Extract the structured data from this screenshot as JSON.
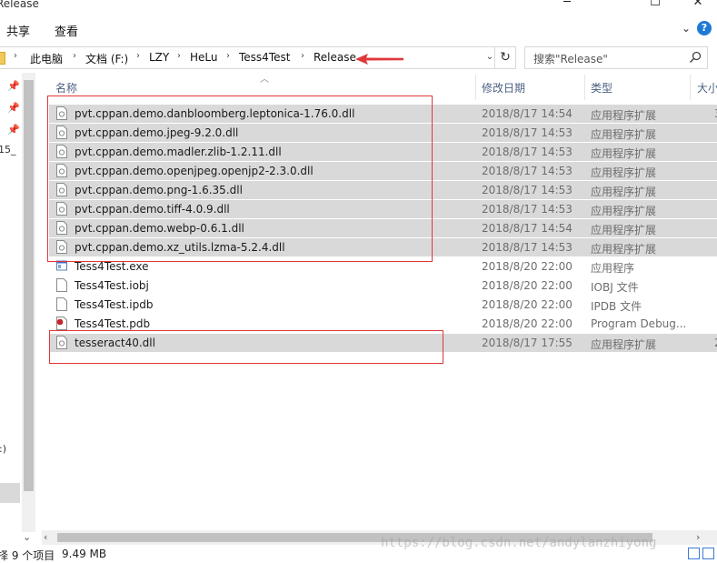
{
  "window": {
    "title": "Release"
  },
  "ribbon": {
    "tabs": [
      "共享",
      "查看"
    ]
  },
  "address": {
    "crumbs": [
      "此电脑",
      "文档 (F:)",
      "LZY",
      "HeLu",
      "Tess4Test",
      "Release"
    ]
  },
  "search": {
    "placeholder": "搜索\"Release\""
  },
  "nav": {
    "text1": "15_",
    "text2": ":)"
  },
  "columns": {
    "name": "名称",
    "date": "修改日期",
    "type": "类型",
    "size": "大小"
  },
  "files": [
    {
      "name": "pvt.cppan.demo.danbloomberg.leptonica-1.76.0.dll",
      "date": "2018/8/17 14:54",
      "type": "应用程序扩展",
      "size": "3",
      "icon": "dll-icon",
      "selected": true
    },
    {
      "name": "pvt.cppan.demo.jpeg-9.2.0.dll",
      "date": "2018/8/17 14:53",
      "type": "应用程序扩展",
      "size": "",
      "icon": "dll-icon",
      "selected": true
    },
    {
      "name": "pvt.cppan.demo.madler.zlib-1.2.11.dll",
      "date": "2018/8/17 14:53",
      "type": "应用程序扩展",
      "size": "",
      "icon": "dll-icon",
      "selected": true
    },
    {
      "name": "pvt.cppan.demo.openjpeg.openjp2-2.3.0.dll",
      "date": "2018/8/17 14:53",
      "type": "应用程序扩展",
      "size": "",
      "icon": "dll-icon",
      "selected": true
    },
    {
      "name": "pvt.cppan.demo.png-1.6.35.dll",
      "date": "2018/8/17 14:53",
      "type": "应用程序扩展",
      "size": "",
      "icon": "dll-icon",
      "selected": true
    },
    {
      "name": "pvt.cppan.demo.tiff-4.0.9.dll",
      "date": "2018/8/17 14:53",
      "type": "应用程序扩展",
      "size": "",
      "icon": "dll-icon",
      "selected": true
    },
    {
      "name": "pvt.cppan.demo.webp-0.6.1.dll",
      "date": "2018/8/17 14:54",
      "type": "应用程序扩展",
      "size": "",
      "icon": "dll-icon",
      "selected": true
    },
    {
      "name": "pvt.cppan.demo.xz_utils.lzma-5.2.4.dll",
      "date": "2018/8/17 14:53",
      "type": "应用程序扩展",
      "size": "",
      "icon": "dll-icon",
      "selected": true
    },
    {
      "name": "Tess4Test.exe",
      "date": "2018/8/20 22:00",
      "type": "应用程序",
      "size": "",
      "icon": "exe-icon",
      "selected": false
    },
    {
      "name": "Tess4Test.iobj",
      "date": "2018/8/20 22:00",
      "type": "IOBJ 文件",
      "size": "",
      "icon": "file-icon",
      "selected": false
    },
    {
      "name": "Tess4Test.ipdb",
      "date": "2018/8/20 22:00",
      "type": "IPDB 文件",
      "size": "",
      "icon": "file-icon",
      "selected": false
    },
    {
      "name": "Tess4Test.pdb",
      "date": "2018/8/20 22:00",
      "type": "Program Debug...",
      "size": "",
      "icon": "pdb-icon",
      "selected": false
    },
    {
      "name": "tesseract40.dll",
      "date": "2018/8/17 17:55",
      "type": "应用程序扩展",
      "size": "2",
      "icon": "dll-icon",
      "selected": true
    }
  ],
  "status": {
    "count": "择 9 个项目",
    "size": "9.49 MB"
  },
  "watermark": "https://blog.csdn.net/andylanzhiyong",
  "colors": {
    "selection": "#d9d9d9",
    "annotation": "#e0373a",
    "accent": "#1e7ad4"
  }
}
